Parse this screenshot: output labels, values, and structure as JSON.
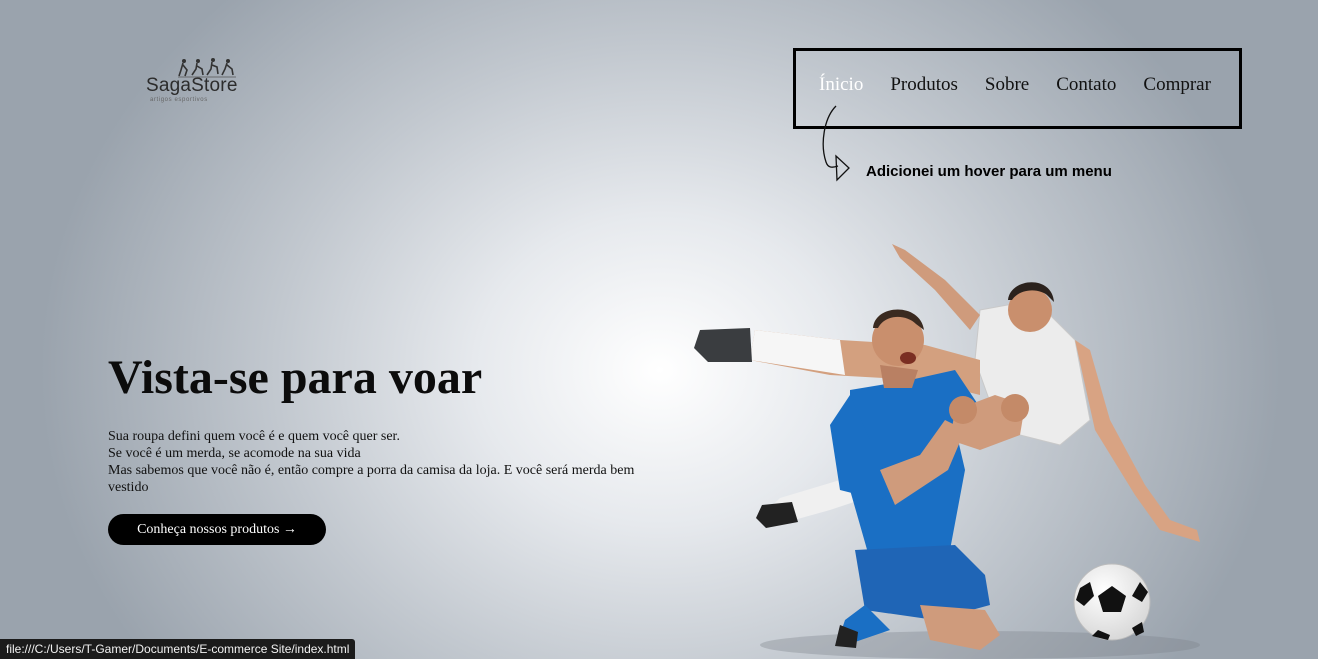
{
  "logo": {
    "text": "SagaStore",
    "tagline": "artigos esportivos"
  },
  "nav": {
    "items": [
      {
        "label": "Ínicio",
        "active": true
      },
      {
        "label": "Produtos",
        "active": false
      },
      {
        "label": "Sobre",
        "active": false
      },
      {
        "label": "Contato",
        "active": false
      },
      {
        "label": "Comprar",
        "active": false
      }
    ]
  },
  "annotation": {
    "text": "Adicionei um hover para um menu"
  },
  "hero": {
    "title": "Vista-se para voar",
    "lines": [
      "Sua roupa defini quem você é e quem você quer ser.",
      "Se você é um merda, se acomode na sua vida",
      "Mas sabemos que você não é, então compre a porra da camisa da loja. E você será merda bem vestido"
    ],
    "cta_label": "Conheça nossos produtos →"
  },
  "statusbar": {
    "url": "file:///C:/Users/T-Gamer/Documents/E-commerce Site/index.html"
  },
  "colors": {
    "active_nav": "#ffffff",
    "jersey_blue": "#1a6fc4",
    "cta_bg": "#000000"
  }
}
